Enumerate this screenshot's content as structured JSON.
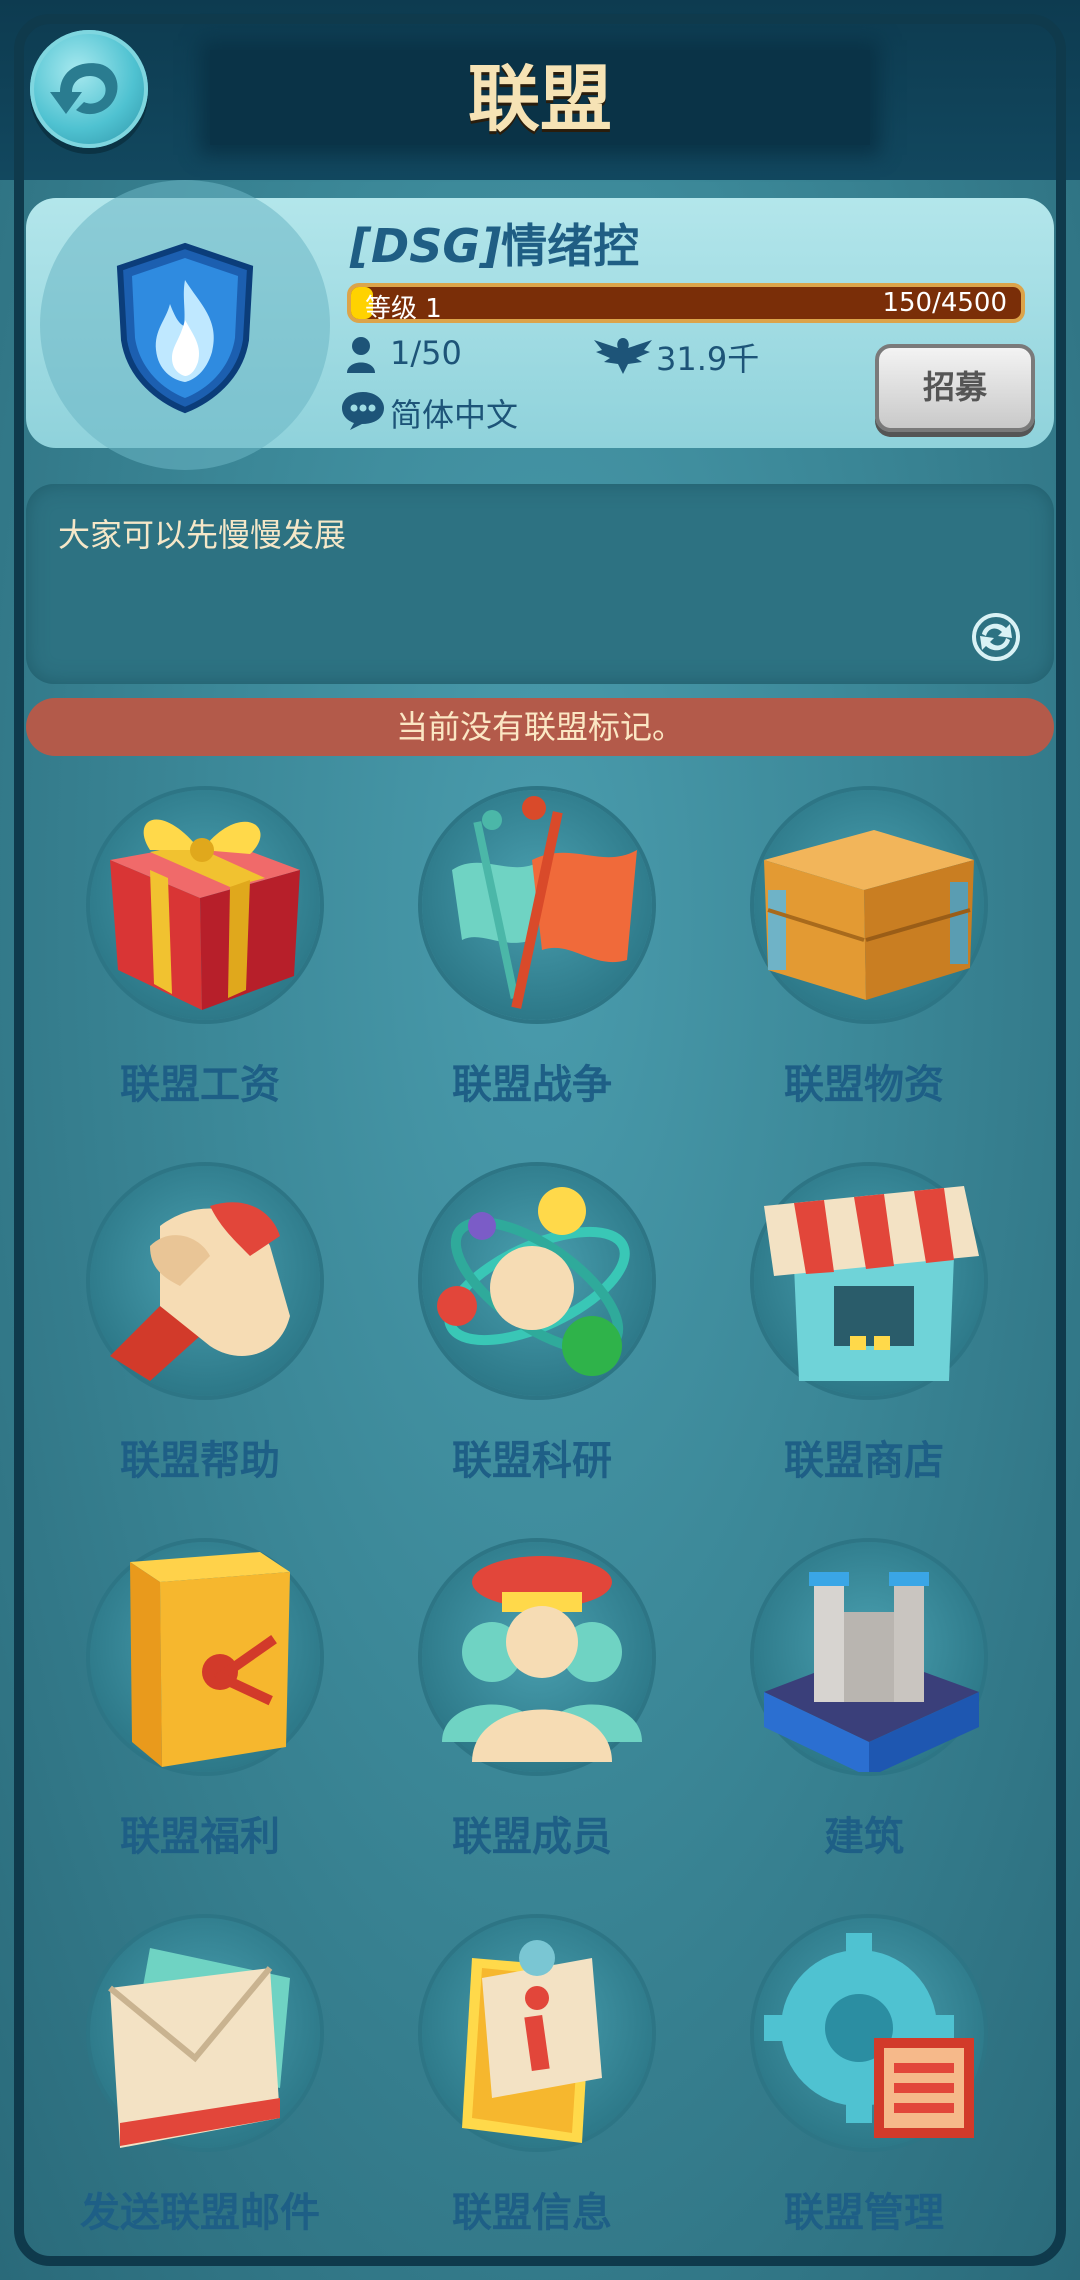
{
  "header": {
    "title": "联盟"
  },
  "alliance": {
    "tag": "[DSG]",
    "name": "情绪控",
    "level_label": "等级 1",
    "exp_text": "150/4500",
    "exp_progress": 0.0333,
    "members": "1/50",
    "power": "31.9千",
    "language": "简体中文",
    "recruit_label": "招募"
  },
  "notice": {
    "text": "大家可以先慢慢发展"
  },
  "banner": {
    "text": "当前没有联盟标记。"
  },
  "menu": [
    {
      "label": "联盟工资",
      "icon": "gift-icon"
    },
    {
      "label": "联盟战争",
      "icon": "war-flag-icon"
    },
    {
      "label": "联盟物资",
      "icon": "supply-crate-icon"
    },
    {
      "label": "联盟帮助",
      "icon": "handshake-icon"
    },
    {
      "label": "联盟科研",
      "icon": "atom-icon"
    },
    {
      "label": "联盟商店",
      "icon": "shop-icon"
    },
    {
      "label": "联盟福利",
      "icon": "safe-icon"
    },
    {
      "label": "联盟成员",
      "icon": "members-icon"
    },
    {
      "label": "建筑",
      "icon": "castle-icon"
    },
    {
      "label": "发送联盟邮件",
      "icon": "mail-icon"
    },
    {
      "label": "联盟信息",
      "icon": "info-clipboard-icon"
    },
    {
      "label": "联盟管理",
      "icon": "gear-icon"
    }
  ],
  "colors": {
    "accent": "#1e5f86",
    "banner": "#b35a4a",
    "progress_fill": "#ffd200",
    "progress_bg": "#7a2e08"
  }
}
